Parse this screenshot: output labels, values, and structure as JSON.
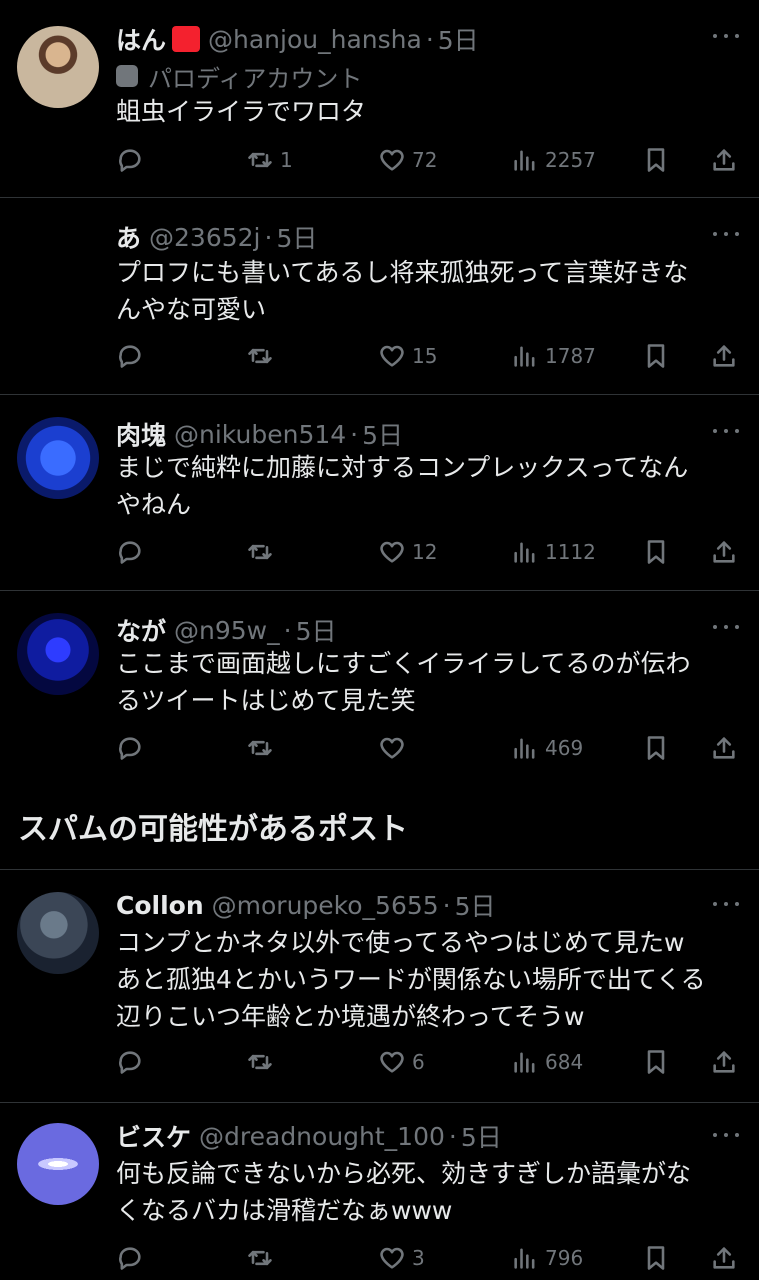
{
  "tweets": [
    {
      "name": "はん",
      "handle": "@hanjou_hansha",
      "time": "5日",
      "parody": "パロディアカウント",
      "lines": [
        "蛆虫イライラでワロタ"
      ],
      "reply": "",
      "retweet": "1",
      "like": "72",
      "views": "2257"
    },
    {
      "name": "あ",
      "handle": "@23652j",
      "time": "5日",
      "lines": [
        "プロフにも書いてあるし将来孤独死って言葉好きな",
        "んやな可愛い"
      ],
      "reply": "",
      "retweet": "",
      "like": "15",
      "views": "1787"
    },
    {
      "name": "肉塊",
      "handle": "@nikuben514",
      "time": "5日",
      "lines": [
        "まじで純粋に加藤に対するコンプレックスってなん",
        "やねん"
      ],
      "reply": "",
      "retweet": "",
      "like": "12",
      "views": "1112"
    },
    {
      "name": "なが",
      "handle": "@n95w_",
      "time": "5日",
      "lines": [
        "ここまで画面越しにすごくイライラしてるのが伝わ",
        "るツイートはじめて見た笑"
      ],
      "reply": "",
      "retweet": "",
      "like": "",
      "views": "469"
    },
    {
      "name": "Collon",
      "handle": "@morupeko_5655",
      "time": "5日",
      "lines": [
        "コンプとかネタ以外で使ってるやつはじめて見たw",
        "あと孤独4とかいうワードが関係ない場所で出てくる",
        "辺りこいつ年齢とか境遇が終わってそうw"
      ],
      "reply": "",
      "retweet": "",
      "like": "6",
      "views": "684"
    },
    {
      "name": "ビスケ",
      "handle": "@dreadnought_100",
      "time": "5日",
      "lines": [
        "何も反論できないから必死、効きすぎしか語彙がな",
        "くなるバカは滑稽だなぁwww"
      ],
      "reply": "",
      "retweet": "",
      "like": "3",
      "views": "796"
    }
  ],
  "section": {
    "title": "スパムの可能性があるポスト"
  },
  "dot": "·",
  "icons": {
    "reply": "reply-icon",
    "retweet": "retweet-icon",
    "like": "heart-icon",
    "views": "views-icon",
    "bookmark": "bookmark-icon",
    "share": "share-icon",
    "more": "more-icon",
    "badge": "red-badge-icon",
    "parody": "parody-mask-icon"
  }
}
